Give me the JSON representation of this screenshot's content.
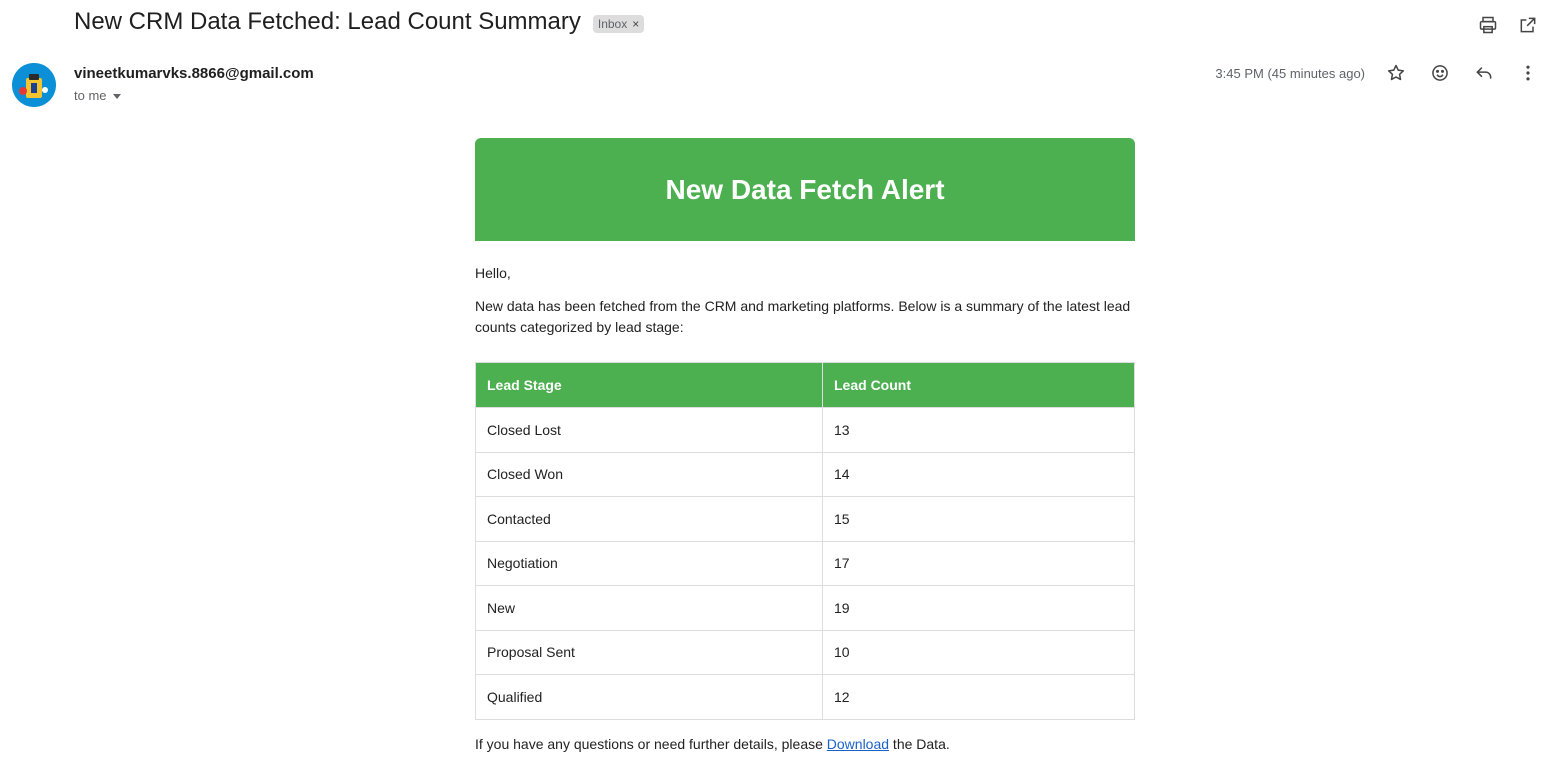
{
  "email": {
    "subject": "New CRM Data Fetched: Lead Count Summary",
    "label": "Inbox",
    "label_remove": "×",
    "sender": "vineetkumarvks.8866@gmail.com",
    "recipient": "to me",
    "timestamp": "3:45 PM (45 minutes ago)"
  },
  "body": {
    "banner_title": "New Data Fetch Alert",
    "greeting": "Hello,",
    "intro": "New data has been fetched from the CRM and marketing platforms. Below is a summary of the latest lead counts categorized by lead stage:",
    "table": {
      "headers": [
        "Lead Stage",
        "Lead Count"
      ],
      "rows": [
        [
          "Closed Lost",
          "13"
        ],
        [
          "Closed Won",
          "14"
        ],
        [
          "Contacted",
          "15"
        ],
        [
          "Negotiation",
          "17"
        ],
        [
          "New",
          "19"
        ],
        [
          "Proposal Sent",
          "10"
        ],
        [
          "Qualified",
          "12"
        ]
      ]
    },
    "footer_before": "If you have any questions or need further details, please ",
    "footer_link": "Download",
    "footer_after": " the Data."
  },
  "icons": {
    "print": "print-icon",
    "open_new_window": "open-in-new-window-icon",
    "star": "star-icon",
    "emoji": "emoji-reaction-icon",
    "reply": "reply-icon",
    "more": "more-vertical-icon"
  },
  "colors": {
    "accent_green": "#4caf50",
    "link_blue": "#1a62c9"
  }
}
